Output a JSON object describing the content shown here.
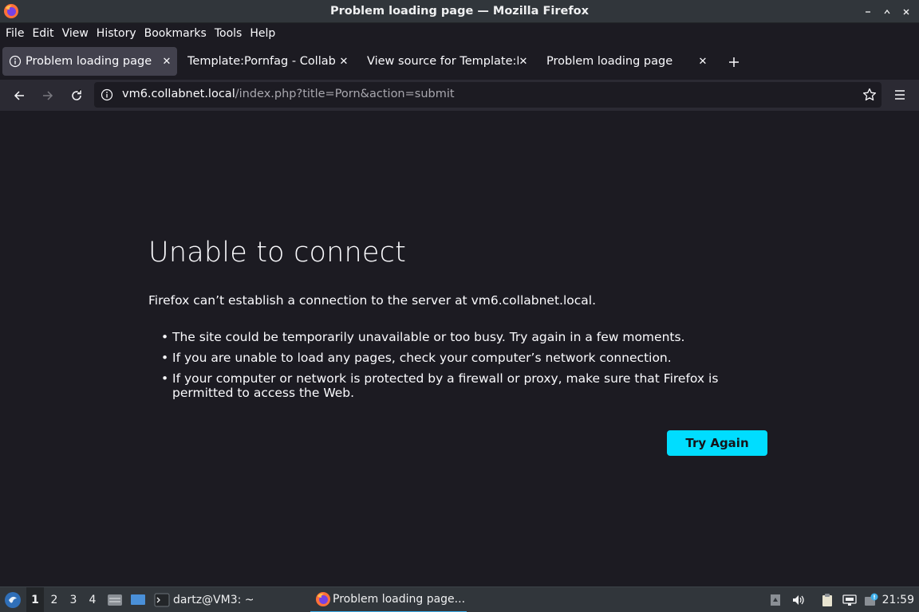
{
  "window": {
    "title": "Problem loading page — Mozilla Firefox",
    "controls": [
      "minimize",
      "maximize",
      "close"
    ]
  },
  "menubar": {
    "items": [
      "File",
      "Edit",
      "View",
      "History",
      "Bookmarks",
      "Tools",
      "Help"
    ]
  },
  "tabs": [
    {
      "label": "Problem loading page",
      "active": true
    },
    {
      "label": "Template:Pornfag - CollabVM",
      "active": false
    },
    {
      "label": "View source for Template:Po",
      "active": false
    },
    {
      "label": "Problem loading page",
      "active": false
    }
  ],
  "navbar": {
    "url_host": "vm6.collabnet.local",
    "url_path": "/index.php?title=Porn&action=submit"
  },
  "error_page": {
    "title": "Unable to connect",
    "description": "Firefox can’t establish a connection to the server at vm6.collabnet.local.",
    "bullets": [
      "The site could be temporarily unavailable or too busy. Try again in a few moments.",
      "If you are unable to load any pages, check your computer’s network connection.",
      "If your computer or network is protected by a firewall or proxy, make sure that Firefox is permitted to access the Web."
    ],
    "button": "Try Again"
  },
  "taskbar": {
    "workspaces": [
      "1",
      "2",
      "3",
      "4"
    ],
    "active_workspace": "1",
    "terminal_label": "dartz@VM3: ~",
    "firefox_label": "Problem loading page...",
    "clock": "21:59"
  },
  "colors": {
    "accent": "#00ddff",
    "background": "#1c1b22",
    "toolbar": "#2b2a33",
    "active_tab": "#42414d"
  }
}
